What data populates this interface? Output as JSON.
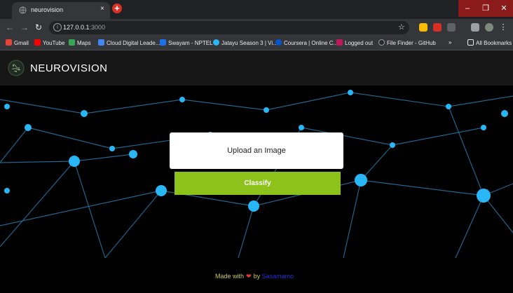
{
  "browser": {
    "tab_title": "neurovision",
    "tab_close": "×",
    "new_tab": "+",
    "window": {
      "minimize": "–",
      "maximize": "❐",
      "close": "✕"
    },
    "nav": {
      "back": "←",
      "forward": "→",
      "reload": "↻"
    },
    "url_host": "127.0.0.1",
    "url_port": ":3000",
    "star": "☆",
    "bookmarks": [
      {
        "label": "Gmail",
        "color": "#ea4335"
      },
      {
        "label": "YouTube",
        "color": "#ff0000"
      },
      {
        "label": "Maps",
        "color": "#34a853"
      },
      {
        "label": "Cloud Digital Leade...",
        "color": "#4285f4"
      },
      {
        "label": "Swayam - NPTEL",
        "color": "#1a73e8"
      },
      {
        "label": "Jatayu Season 3 | Vi...",
        "color": "#29b6f6"
      },
      {
        "label": "Coursera | Online C...",
        "color": "#0056d2"
      },
      {
        "label": "Logged out",
        "color": "#c2185b"
      },
      {
        "label": "File Finder - GitHub",
        "color": "#24292e"
      }
    ],
    "more_bookmarks": "»",
    "all_bookmarks": "All Bookmarks"
  },
  "app": {
    "brand": "NEUROVISION",
    "upload_label": "Upload an Image",
    "classify_label": "Classify",
    "footer": {
      "made_with": "Made with",
      "heart": "❤",
      "by": "by",
      "author": "Sasamamo"
    }
  },
  "colors": {
    "accent": "#8cc21a",
    "node": "#29b6f6",
    "header_bg": "#171717"
  }
}
